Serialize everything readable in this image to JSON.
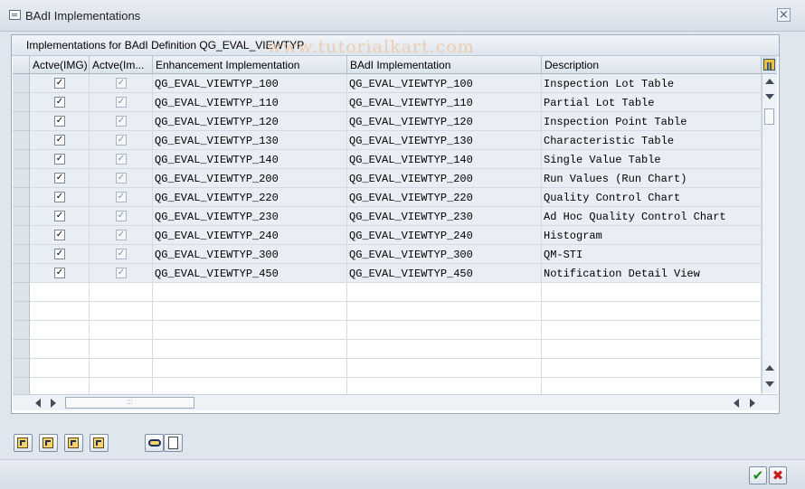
{
  "window": {
    "title": "BAdI Implementations",
    "close_glyph": "×"
  },
  "panel": {
    "caption": "Implementations for BAdI Definition QG_EVAL_VIEWTYP",
    "watermark": "www.tutorialkart.com"
  },
  "table": {
    "columns": [
      "Actve(IMG)",
      "Actve(Im...",
      "Enhancement Implementation",
      "BAdI Implementation",
      "Description"
    ],
    "rows": [
      {
        "active_img": true,
        "active_impl": true,
        "enhancement": "QG_EVAL_VIEWTYP_100",
        "badi": "QG_EVAL_VIEWTYP_100",
        "description": "Inspection Lot Table"
      },
      {
        "active_img": true,
        "active_impl": true,
        "enhancement": "QG_EVAL_VIEWTYP_110",
        "badi": "QG_EVAL_VIEWTYP_110",
        "description": "Partial Lot Table"
      },
      {
        "active_img": true,
        "active_impl": true,
        "enhancement": "QG_EVAL_VIEWTYP_120",
        "badi": "QG_EVAL_VIEWTYP_120",
        "description": "Inspection Point Table"
      },
      {
        "active_img": true,
        "active_impl": true,
        "enhancement": "QG_EVAL_VIEWTYP_130",
        "badi": "QG_EVAL_VIEWTYP_130",
        "description": "Characteristic Table"
      },
      {
        "active_img": true,
        "active_impl": true,
        "enhancement": "QG_EVAL_VIEWTYP_140",
        "badi": "QG_EVAL_VIEWTYP_140",
        "description": "Single Value Table"
      },
      {
        "active_img": true,
        "active_impl": true,
        "enhancement": "QG_EVAL_VIEWTYP_200",
        "badi": "QG_EVAL_VIEWTYP_200",
        "description": "Run Values (Run Chart)"
      },
      {
        "active_img": true,
        "active_impl": true,
        "enhancement": "QG_EVAL_VIEWTYP_220",
        "badi": "QG_EVAL_VIEWTYP_220",
        "description": "Quality Control Chart"
      },
      {
        "active_img": true,
        "active_impl": true,
        "enhancement": "QG_EVAL_VIEWTYP_230",
        "badi": "QG_EVAL_VIEWTYP_230",
        "description": "Ad Hoc Quality Control Chart"
      },
      {
        "active_img": true,
        "active_impl": true,
        "enhancement": "QG_EVAL_VIEWTYP_240",
        "badi": "QG_EVAL_VIEWTYP_240",
        "description": "Histogram"
      },
      {
        "active_img": true,
        "active_impl": true,
        "enhancement": "QG_EVAL_VIEWTYP_300",
        "badi": "QG_EVAL_VIEWTYP_300",
        "description": "QM-STI"
      },
      {
        "active_img": true,
        "active_impl": true,
        "enhancement": "QG_EVAL_VIEWTYP_450",
        "badi": "QG_EVAL_VIEWTYP_450",
        "description": "Notification Detail View"
      }
    ],
    "empty_rows": 6,
    "check_glyph": "✓"
  },
  "toolbar": {
    "buttons": [
      "select-all-icon",
      "deselect-all-icon",
      "expand-icon",
      "collapse-icon"
    ],
    "extra_buttons": [
      "find-icon",
      "new-document-icon"
    ]
  },
  "footer": {
    "ok_glyph": "✔",
    "cancel_glyph": "✖"
  },
  "colors": {
    "row_alt": "#e9eef4",
    "ok_green": "#1e8a1e",
    "cancel_red": "#c81e1e"
  }
}
